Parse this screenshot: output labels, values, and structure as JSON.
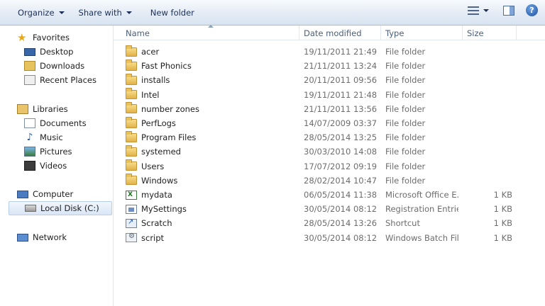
{
  "toolbar": {
    "organize_label": "Organize",
    "share_label": "Share with",
    "new_folder_label": "New folder",
    "help_label": "?"
  },
  "nav": {
    "favorites": "Favorites",
    "desktop": "Desktop",
    "downloads": "Downloads",
    "recent_places": "Recent Places",
    "libraries": "Libraries",
    "documents": "Documents",
    "music": "Music",
    "pictures": "Pictures",
    "videos": "Videos",
    "computer": "Computer",
    "local_disk": "Local Disk (C:)",
    "network": "Network"
  },
  "columns": {
    "name": "Name",
    "date": "Date modified",
    "type": "Type",
    "size": "Size"
  },
  "files": [
    {
      "name": "acer",
      "date": "19/11/2011 21:49",
      "type": "File folder",
      "size": "",
      "icon": "folder-icon"
    },
    {
      "name": "Fast Phonics",
      "date": "21/11/2011 13:24",
      "type": "File folder",
      "size": "",
      "icon": "folder-icon"
    },
    {
      "name": "installs",
      "date": "20/11/2011 09:56",
      "type": "File folder",
      "size": "",
      "icon": "folder-icon"
    },
    {
      "name": "Intel",
      "date": "19/11/2011 21:48",
      "type": "File folder",
      "size": "",
      "icon": "folder-icon"
    },
    {
      "name": "number zones",
      "date": "21/11/2011 13:56",
      "type": "File folder",
      "size": "",
      "icon": "folder-icon"
    },
    {
      "name": "PerfLogs",
      "date": "14/07/2009 03:37",
      "type": "File folder",
      "size": "",
      "icon": "folder-icon"
    },
    {
      "name": "Program Files",
      "date": "28/05/2014 13:25",
      "type": "File folder",
      "size": "",
      "icon": "folder-icon"
    },
    {
      "name": "systemed",
      "date": "30/03/2010 14:08",
      "type": "File folder",
      "size": "",
      "icon": "folder-icon"
    },
    {
      "name": "Users",
      "date": "17/07/2012 09:19",
      "type": "File folder",
      "size": "",
      "icon": "folder-icon"
    },
    {
      "name": "Windows",
      "date": "28/02/2014 10:47",
      "type": "File folder",
      "size": "",
      "icon": "folder-icon"
    },
    {
      "name": "mydata",
      "date": "06/05/2014 11:38",
      "type": "Microsoft Office E...",
      "size": "1 KB",
      "icon": "excel-icon"
    },
    {
      "name": "MySettings",
      "date": "30/05/2014 08:12",
      "type": "Registration Entries",
      "size": "1 KB",
      "icon": "reg-icon"
    },
    {
      "name": "Scratch",
      "date": "28/05/2014 13:26",
      "type": "Shortcut",
      "size": "1 KB",
      "icon": "shortcut-icon"
    },
    {
      "name": "script",
      "date": "30/05/2014 08:12",
      "type": "Windows Batch File",
      "size": "1 KB",
      "icon": "bat-icon"
    }
  ]
}
